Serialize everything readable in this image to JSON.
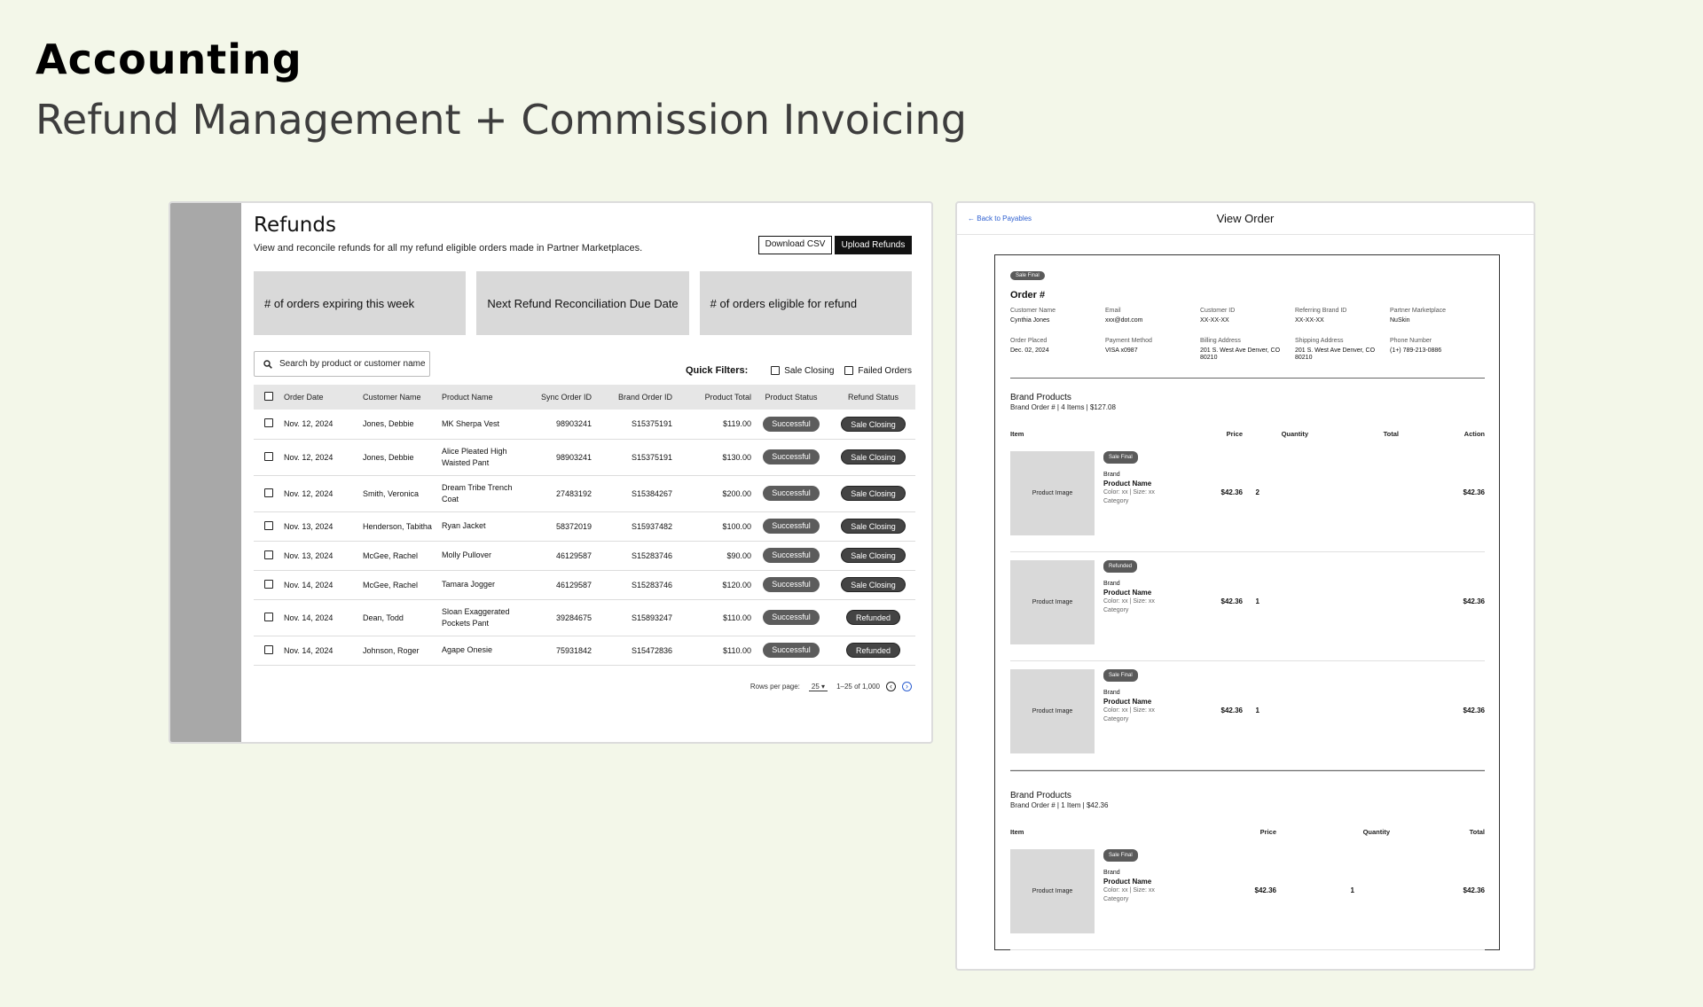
{
  "header": {
    "title": "Accounting",
    "subtitle": "Refund Management + Commission Invoicing"
  },
  "refunds": {
    "title": "Refunds",
    "description": "View and reconcile refunds for all my refund eligible orders made in Partner Marketplaces.",
    "download_csv": "Download CSV",
    "upload_refunds": "Upload Refunds",
    "cards": [
      "# of orders expiring this week",
      "Next Refund Reconciliation Due Date",
      "# of orders eligible for refund"
    ],
    "search_placeholder": "Search by product or customer name",
    "quick_filters": {
      "label": "Quick Filters:",
      "options": [
        "Sale Closing",
        "Failed Orders"
      ]
    },
    "columns": [
      "Order Date",
      "Customer Name",
      "Product Name",
      "Sync Order ID",
      "Brand Order ID",
      "Product Total",
      "Product Status",
      "Refund Status"
    ],
    "rows": [
      {
        "date": "Nov. 12, 2024",
        "customer": "Jones, Debbie",
        "product": "MK Sherpa Vest",
        "sync": "98903241",
        "brand": "S15375191",
        "total": "$119.00",
        "pstatus": "Successful",
        "rstatus": "Sale Closing"
      },
      {
        "date": "Nov. 12, 2024",
        "customer": "Jones, Debbie",
        "product": "Alice Pleated High Waisted Pant",
        "sync": "98903241",
        "brand": "S15375191",
        "total": "$130.00",
        "pstatus": "Successful",
        "rstatus": "Sale Closing"
      },
      {
        "date": "Nov. 12, 2024",
        "customer": "Smith, Veronica",
        "product": "Dream Tribe Trench Coat",
        "sync": "27483192",
        "brand": "S15384267",
        "total": "$200.00",
        "pstatus": "Successful",
        "rstatus": "Sale Closing"
      },
      {
        "date": "Nov. 13, 2024",
        "customer": "Henderson, Tabitha",
        "product": "Ryan Jacket",
        "sync": "58372019",
        "brand": "S15937482",
        "total": "$100.00",
        "pstatus": "Successful",
        "rstatus": "Sale Closing"
      },
      {
        "date": "Nov. 13, 2024",
        "customer": "McGee, Rachel",
        "product": "Molly Pullover",
        "sync": "46129587",
        "brand": "S15283746",
        "total": "$90.00",
        "pstatus": "Successful",
        "rstatus": "Sale Closing"
      },
      {
        "date": "Nov. 14, 2024",
        "customer": "McGee, Rachel",
        "product": "Tamara Jogger",
        "sync": "46129587",
        "brand": "S15283746",
        "total": "$120.00",
        "pstatus": "Successful",
        "rstatus": "Sale Closing"
      },
      {
        "date": "Nov. 14, 2024",
        "customer": "Dean, Todd",
        "product": "Sloan Exaggerated Pockets Pant",
        "sync": "39284675",
        "brand": "S15893247",
        "total": "$110.00",
        "pstatus": "Successful",
        "rstatus": "Refunded"
      },
      {
        "date": "Nov. 14, 2024",
        "customer": "Johnson, Roger",
        "product": "Agape Onesie",
        "sync": "75931842",
        "brand": "S15472836",
        "total": "$110.00",
        "pstatus": "Successful",
        "rstatus": "Refunded"
      }
    ],
    "pagination": {
      "rows_label": "Rows per page:",
      "rows_value": "25",
      "range": "1–25 of 1,000"
    }
  },
  "view_order": {
    "back_link": "Back to Payables",
    "title": "View Order",
    "status_tag": "Sale Final",
    "order_label": "Order #",
    "info_rows": [
      [
        {
          "label": "Customer Name",
          "value": "Cynthia Jones"
        },
        {
          "label": "Email",
          "value": "xxx@dot.com"
        },
        {
          "label": "Customer ID",
          "value": "XX-XX-XX"
        },
        {
          "label": "Referring Brand ID",
          "value": "XX-XX-XX"
        },
        {
          "label": "Partner Marketplace",
          "value": "NuSkin"
        }
      ],
      [
        {
          "label": "Order Placed",
          "value": "Dec. 02, 2024"
        },
        {
          "label": "Payment Method",
          "value": "VISA x0987"
        },
        {
          "label": "Billing Address",
          "value": "201 S. West Ave Denver, CO 80210"
        },
        {
          "label": "Shipping Address",
          "value": "201 S. West Ave Denver, CO 80210"
        },
        {
          "label": "Phone Number",
          "value": "(1+) 789-213-0886"
        }
      ]
    ],
    "groups": [
      {
        "title": "Brand Products",
        "meta": "Brand Order #  |  4 Items  |  $127.08",
        "headers": {
          "item": "Item",
          "price": "Price",
          "quantity": "Quantity",
          "total": "Total",
          "action": "Action"
        },
        "products": [
          {
            "tag": "Sale Final",
            "image": "Product Image",
            "brand": "Brand",
            "name": "Product Name",
            "attrs": "Color: xx  |  Size: xx",
            "category": "Category",
            "price": "$42.36",
            "qty": "2",
            "total": "$42.36"
          },
          {
            "tag": "Refunded",
            "image": "Product Image",
            "brand": "Brand",
            "name": "Product Name",
            "attrs": "Color: xx  |  Size: xx",
            "category": "Category",
            "price": "$42.36",
            "qty": "1",
            "total": "$42.36"
          },
          {
            "tag": "Sale Final",
            "image": "Product Image",
            "brand": "Brand",
            "name": "Product Name",
            "attrs": "Color: xx  |  Size: xx",
            "category": "Category",
            "price": "$42.36",
            "qty": "1",
            "total": "$42.36"
          }
        ]
      },
      {
        "title": "Brand Products",
        "meta": "Brand Order #  |  1 Item  |  $42.36",
        "headers": {
          "item": "Item",
          "price": "Price",
          "quantity": "Quantity",
          "total": "Total"
        },
        "products": [
          {
            "tag": "Sale Final",
            "image": "Product Image",
            "brand": "Brand",
            "name": "Product Name",
            "attrs": "Color: xx  |  Size: xx",
            "category": "Category",
            "price": "$42.36",
            "qty": "1",
            "total": "$42.36"
          }
        ]
      }
    ]
  }
}
